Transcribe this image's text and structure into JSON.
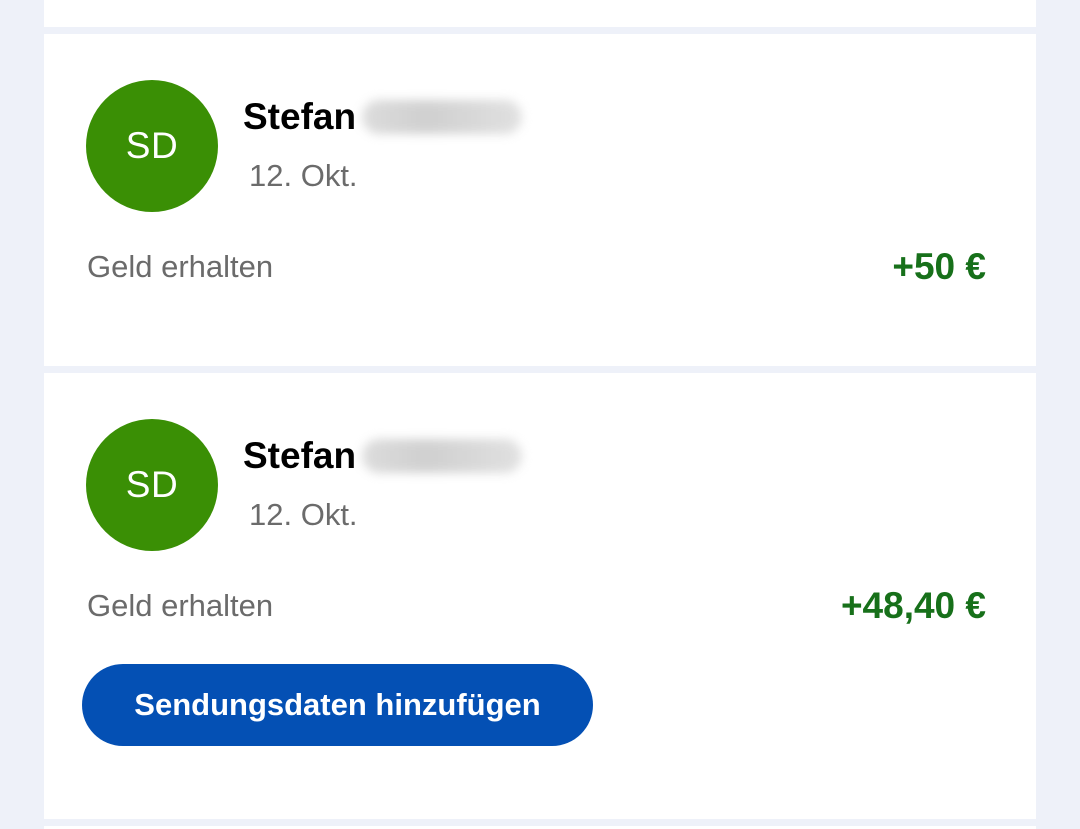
{
  "colors": {
    "page_background": "#eef1f9",
    "card_background": "#ffffff",
    "avatar_green": "#3a8f05",
    "amount_green": "#17701a",
    "button_blue": "#0450b4",
    "muted_text": "#6b6b6b"
  },
  "transactions": [
    {
      "avatar_initials": "SD",
      "name": "Stefan",
      "name_redacted": true,
      "date": "12. Okt.",
      "type_label": "Geld erhalten",
      "amount": "+50 €"
    },
    {
      "avatar_initials": "SD",
      "name": "Stefan",
      "name_redacted": true,
      "date": "12. Okt.",
      "type_label": "Geld erhalten",
      "amount": "+48,40 €",
      "action_button": "Sendungsdaten hinzufügen"
    }
  ]
}
